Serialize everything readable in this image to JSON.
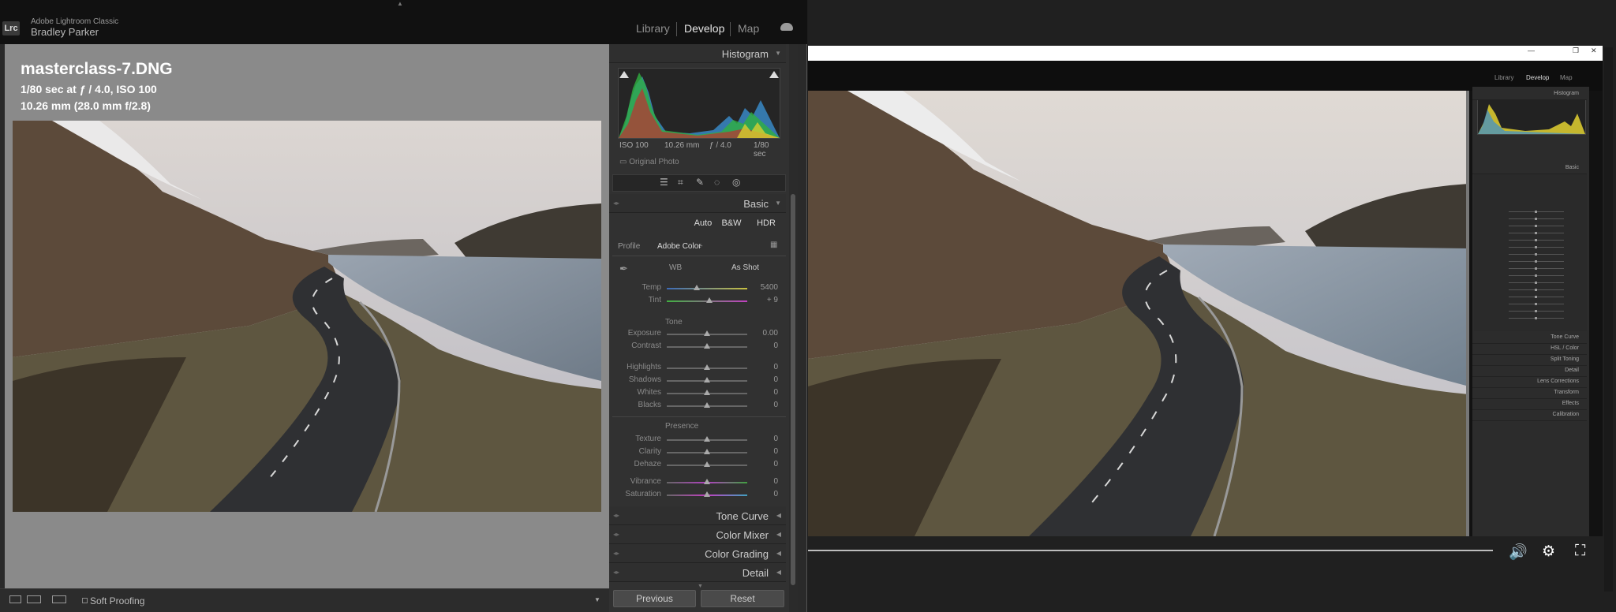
{
  "app": {
    "logo_text": "Lrc",
    "name": "Adobe Lightroom Classic",
    "user": "Bradley Parker",
    "modules": [
      "Library",
      "Develop",
      "Map"
    ],
    "active_module": "Develop"
  },
  "photo_info": {
    "filename": "masterclass-7.DNG",
    "exposure_line": "1/80 sec at ƒ / 4.0, ISO 100",
    "lens_line": "10.26 mm (28.0 mm f/2.8)"
  },
  "histogram": {
    "title": "Histogram",
    "iso": "ISO 100",
    "focal": "10.26 mm",
    "aperture": "ƒ / 4.0",
    "shutter": "1/80 sec",
    "original_label": "Original Photo"
  },
  "basic": {
    "title": "Basic",
    "buttons": [
      "Auto",
      "B&W",
      "HDR"
    ],
    "profile_label": "Profile",
    "profile_value": "Adobe Color",
    "wb_label": "WB",
    "wb_value": "As Shot",
    "temp_label": "Temp",
    "temp_value": "5400",
    "tint_label": "Tint",
    "tint_value": "+ 9",
    "tone_head": "Tone",
    "exposure_label": "Exposure",
    "exposure_value": "0.00",
    "contrast_label": "Contrast",
    "contrast_value": "0",
    "highlights_label": "Highlights",
    "highlights_value": "0",
    "shadows_label": "Shadows",
    "shadows_value": "0",
    "whites_label": "Whites",
    "whites_value": "0",
    "blacks_label": "Blacks",
    "blacks_value": "0",
    "presence_head": "Presence",
    "texture_label": "Texture",
    "texture_value": "0",
    "clarity_label": "Clarity",
    "clarity_value": "0",
    "dehaze_label": "Dehaze",
    "dehaze_value": "0",
    "vibrance_label": "Vibrance",
    "vibrance_value": "0",
    "saturation_label": "Saturation",
    "saturation_value": "0"
  },
  "panels": {
    "tone_curve": "Tone Curve",
    "color_mixer": "Color Mixer",
    "color_grading": "Color Grading",
    "detail": "Detail"
  },
  "footer": {
    "previous": "Previous",
    "reset": "Reset",
    "soft_proofing": "Soft Proofing"
  },
  "video": {
    "modules": [
      "Library",
      "Develop",
      "Map"
    ],
    "panels": [
      "Histogram",
      "Basic",
      "Tone Curve",
      "HSL / Color",
      "Split Toning",
      "Detail",
      "Lens Corrections",
      "Transform",
      "Effects",
      "Calibration"
    ]
  },
  "colors": {
    "accent_active": "#e6e6e6",
    "panel_bg": "#313131",
    "canvas_bg": "#8a8a8a"
  }
}
